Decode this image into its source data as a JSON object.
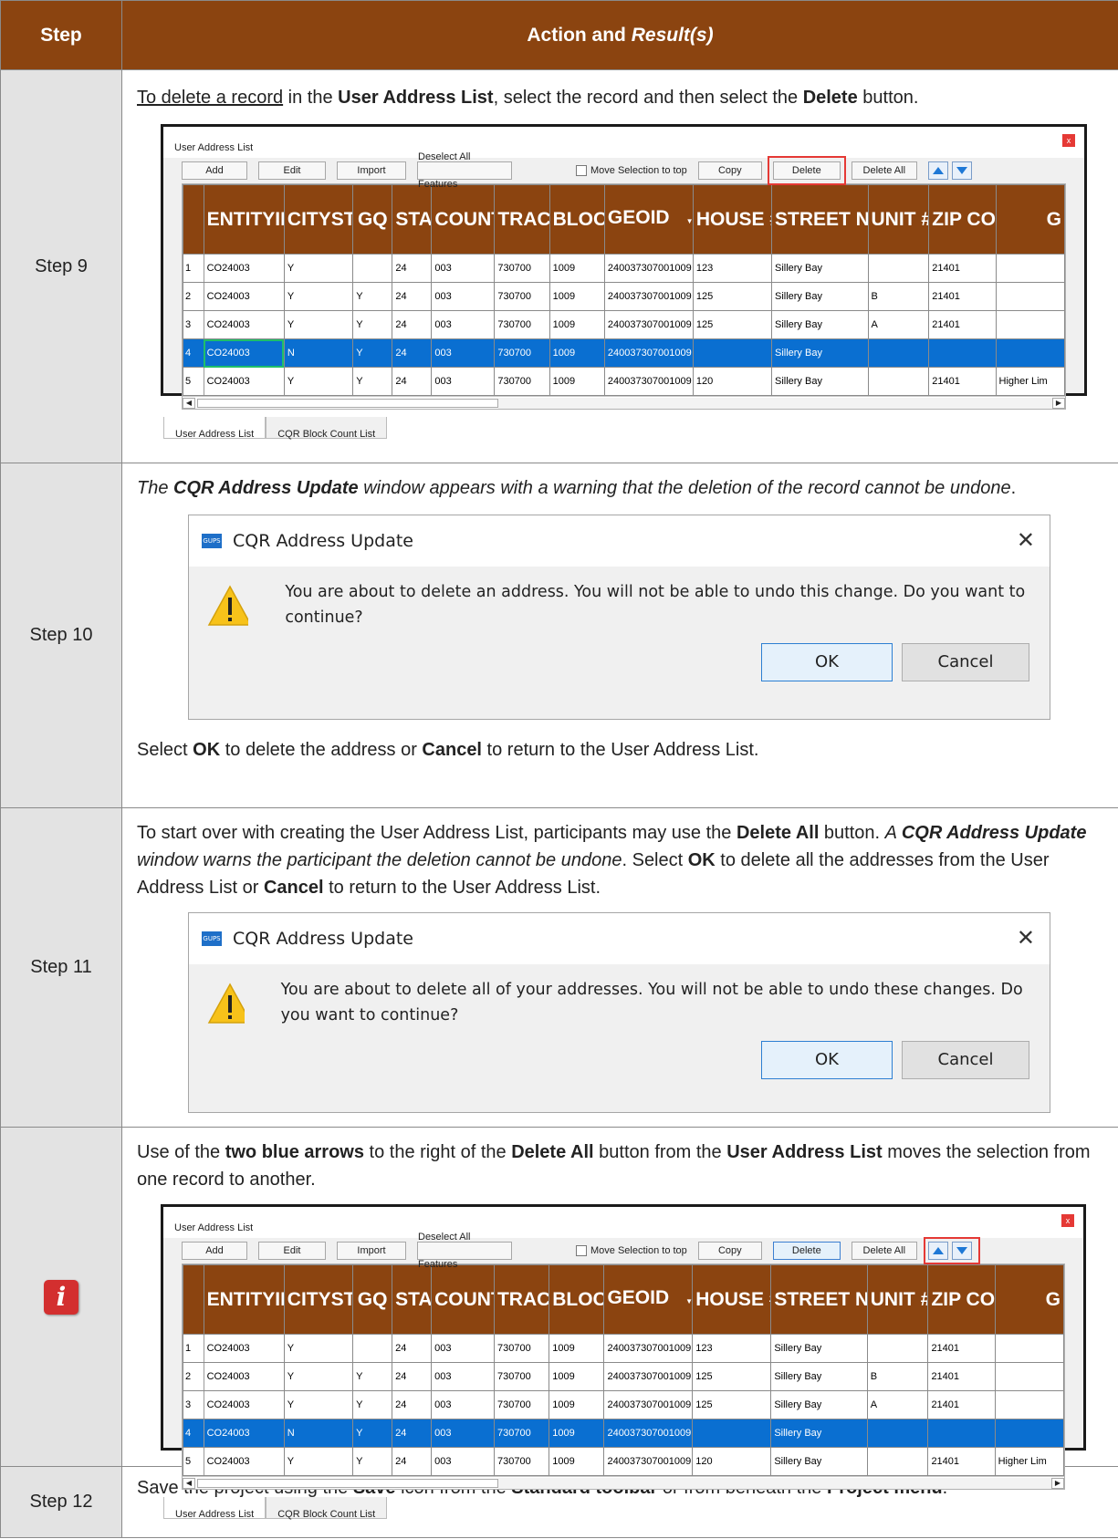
{
  "header": {
    "step": "Step",
    "action_plain": "Action and ",
    "action_italic": "Result(s)"
  },
  "ui": {
    "window_title": "User Address List",
    "close_x": "x",
    "buttons": {
      "add": "Add",
      "edit": "Edit",
      "import": "Import",
      "deselect": "Deselect All Features",
      "move_sel": "Move Selection to top",
      "copy": "Copy",
      "delete": "Delete",
      "delete_all": "Delete All"
    },
    "columns": [
      "ENTITYID",
      "CITYSTYLE",
      "GQ",
      "STATE",
      "COUNTY",
      "TRACT",
      "BLOCK",
      "GEOID",
      "HOUSE #",
      "STREET NAME",
      "UNIT #",
      "ZIP CODE",
      "G"
    ],
    "sort_arrow": "▼",
    "rows": [
      {
        "n": "1",
        "c": [
          "CO24003",
          "Y",
          "",
          "24",
          "003",
          "730700",
          "1009",
          "240037307001009",
          "123",
          "Sillery Bay",
          "",
          "21401",
          ""
        ]
      },
      {
        "n": "2",
        "c": [
          "CO24003",
          "Y",
          "Y",
          "24",
          "003",
          "730700",
          "1009",
          "240037307001009",
          "125",
          "Sillery Bay",
          "B",
          "21401",
          ""
        ]
      },
      {
        "n": "3",
        "c": [
          "CO24003",
          "Y",
          "Y",
          "24",
          "003",
          "730700",
          "1009",
          "240037307001009",
          "125",
          "Sillery Bay",
          "A",
          "21401",
          ""
        ]
      },
      {
        "n": "4",
        "c": [
          "CO24003",
          "N",
          "Y",
          "24",
          "003",
          "730700",
          "1009",
          "240037307001009",
          "",
          "Sillery Bay",
          "",
          "",
          ""
        ]
      },
      {
        "n": "5",
        "c": [
          "CO24003",
          "Y",
          "Y",
          "24",
          "003",
          "730700",
          "1009",
          "240037307001009",
          "120",
          "Sillery Bay",
          "",
          "21401",
          "Higher Lim"
        ]
      }
    ],
    "tabs": [
      "User Address List",
      "CQR Block Count List"
    ]
  },
  "step9": {
    "label": "Step 9",
    "t1": "To delete a record",
    "t2": " in the ",
    "b1": "User Address List",
    "t3": ", select the record and then select the ",
    "b2": "Delete",
    "t4": " button."
  },
  "step10": {
    "label": "Step 10",
    "i1": "The ",
    "bi1": "CQR Address Update",
    "i2": " window appears with a warning that the deletion of the record cannot be undone",
    "t1": ".",
    "dialog_title": "CQR Address Update",
    "logo": "GUPS",
    "close": "✕",
    "message": "You are about to delete an address. You will not be able to undo this change. Do you want to continue?",
    "ok": "OK",
    "cancel": "Cancel",
    "f1": "Select ",
    "fb1": "OK",
    "f2": " to delete the address or ",
    "fb2": "Cancel",
    "f3": " to return to the User Address List."
  },
  "step11": {
    "label": "Step 11",
    "t1": "To start over with creating the User Address List, participants may use the ",
    "b1": "Delete All",
    "t2": " button. ",
    "i1": "A ",
    "bi1": "CQR Address Update",
    "i2": " window warns the participant the deletion cannot be undone",
    "t3": ". Select ",
    "b2": "OK",
    "t4": " to delete all the addresses from the User Address List or ",
    "b3": "Cancel",
    "t5": " to return to the User Address List.",
    "message": "You are about to delete all of your addresses. You will not be able to undo these changes. Do you want to continue?"
  },
  "info": {
    "t1": "Use of the ",
    "b1": "two blue arrows",
    "t2": " to the right of the ",
    "b2": "Delete All",
    "t3": " button from the ",
    "b3": "User Address List",
    "t4": " moves the selection from one record to another.",
    "icon_letter": "i"
  },
  "step12": {
    "label": "Step 12",
    "t1": "Save the project using the ",
    "b1": "Save",
    "t2": " icon from the ",
    "b2": "Standard toolbar",
    "t3": " or from beneath the ",
    "b3": "Project menu",
    "t4": "."
  },
  "colors": {
    "header_bg": "#8b4410",
    "step_bg": "#e3e3e3",
    "selection": "#0a6fd1",
    "highlight_red": "#e53935"
  }
}
